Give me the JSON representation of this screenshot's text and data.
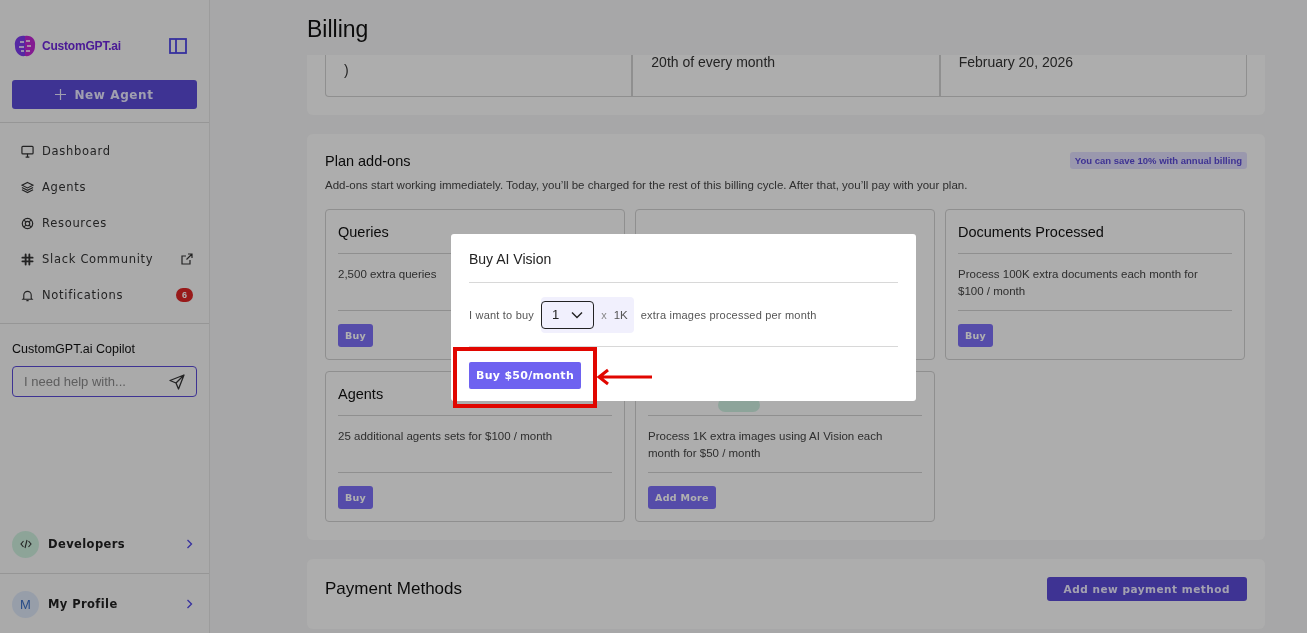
{
  "sidebar": {
    "brand": "CustomGPT.ai",
    "new_agent": "New Agent",
    "nav": [
      {
        "label": "Dashboard",
        "kind": "monitor"
      },
      {
        "label": "Agents",
        "kind": "layers"
      },
      {
        "label": "Resources",
        "kind": "lifebuoy"
      },
      {
        "label": "Slack Community",
        "kind": "slack",
        "external": true
      },
      {
        "label": "Notifications",
        "kind": "bell",
        "badge": "6"
      }
    ],
    "copilot": {
      "title": "CustomGPT.ai Copilot",
      "placeholder": "I need help with..."
    },
    "developers": "Developers",
    "profile": {
      "initial": "M",
      "name": "My Profile"
    }
  },
  "page": {
    "title": "Billing"
  },
  "summary_cards": [
    {
      "text": ")"
    },
    {
      "text": "20th of every month"
    },
    {
      "text": "February 20, 2026"
    }
  ],
  "addons": {
    "title": "Plan add-ons",
    "badge": "You can save 10% with annual billing",
    "description": "Add-ons start working immediately. Today, you’ll be charged for the rest of this billing cycle. After that, you’ll pay with your plan.",
    "cards": [
      {
        "kind": "addon",
        "title": "Queries",
        "description": "2,500 extra queries",
        "button": "Buy"
      },
      {
        "kind": "covered"
      },
      {
        "kind": "addon",
        "title": "Documents Processed",
        "description": "Process 100K extra documents each month for $100 / month",
        "button": "Buy"
      },
      {
        "kind": "addon",
        "title": "Agents",
        "description": "25 additional agents sets for $100 / month",
        "button": "Buy"
      },
      {
        "kind": "covered_head",
        "description": "Process 1K extra images using AI Vision each month for $50 / month",
        "button": "Add More"
      }
    ]
  },
  "payment": {
    "title": "Payment Methods",
    "button": "Add new payment method"
  },
  "modal": {
    "title": "Buy AI Vision",
    "lead": "I want to buy",
    "quantity": "1",
    "times": "x",
    "unit": "1K",
    "trail": "extra images processed per month",
    "button": "Buy $50/month"
  }
}
